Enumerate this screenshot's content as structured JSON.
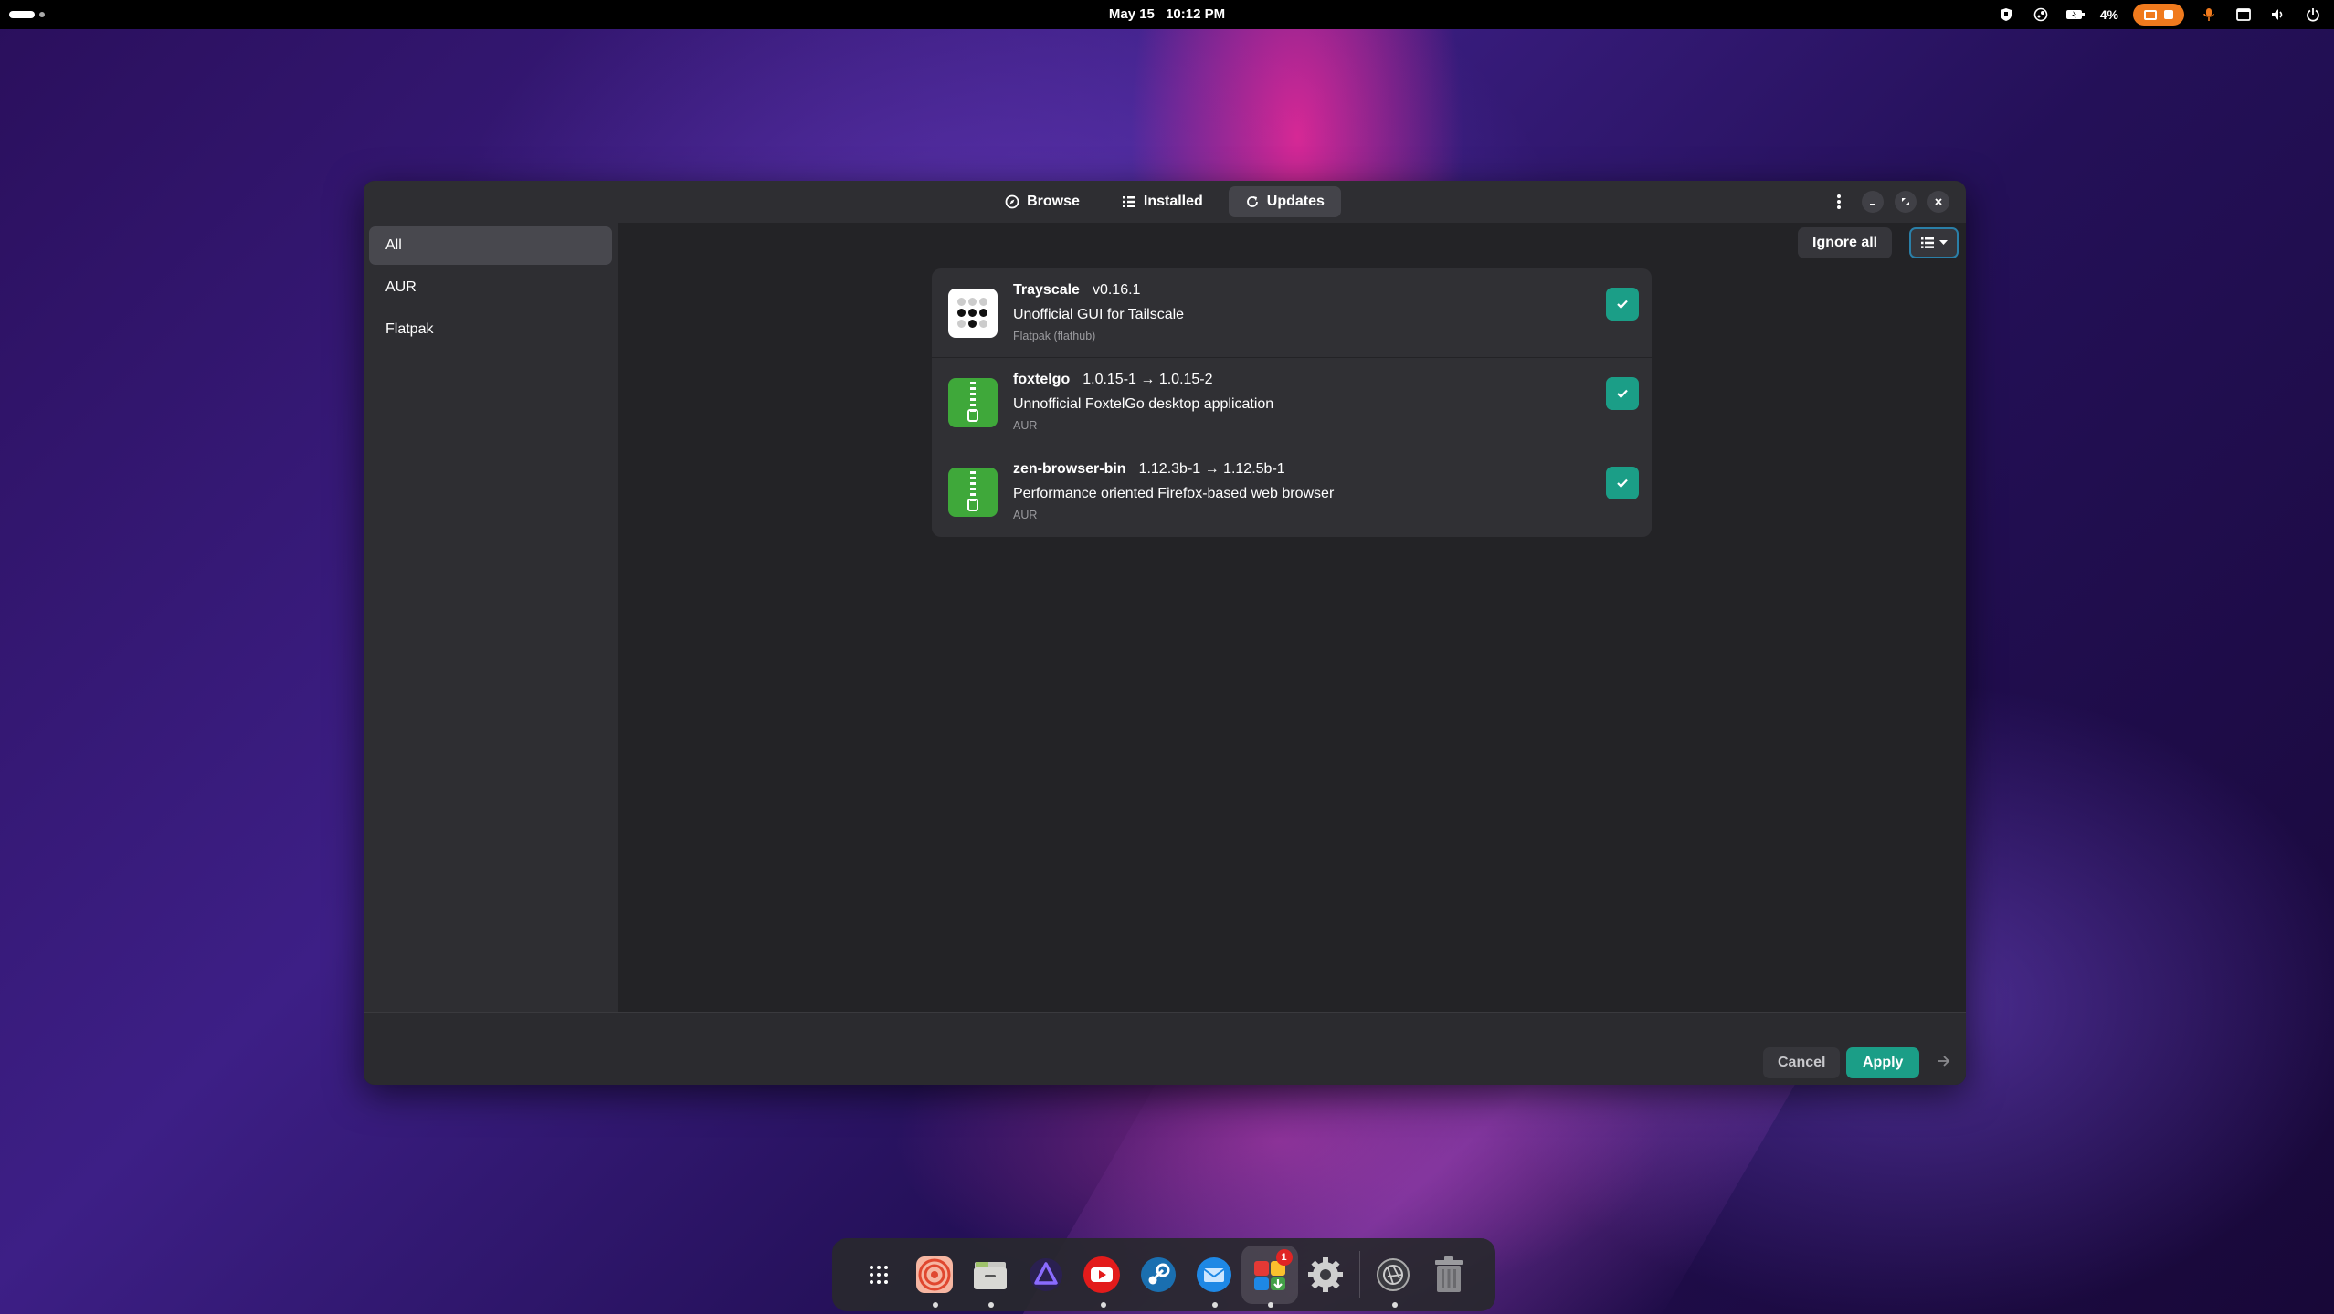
{
  "topbar": {
    "date": "May 15",
    "time": "10:12 PM",
    "battery_percent": "4%",
    "tray_icons": [
      "shield-icon",
      "steam-icon",
      "battery-icon",
      "recording-indicator-icon",
      "microphone-icon",
      "window-icon",
      "volume-icon",
      "power-icon"
    ]
  },
  "window": {
    "tabs": [
      {
        "label": "Browse",
        "icon": "compass-icon",
        "active": false
      },
      {
        "label": "Installed",
        "icon": "list-icon",
        "active": false
      },
      {
        "label": "Updates",
        "icon": "refresh-icon",
        "active": true
      }
    ],
    "sidebar": {
      "items": [
        {
          "label": "All",
          "active": true
        },
        {
          "label": "AUR",
          "active": false
        },
        {
          "label": "Flatpak",
          "active": false
        }
      ]
    },
    "toolbar": {
      "ignore_all_label": "Ignore all",
      "view_icon": "list-view-icon"
    },
    "updates": [
      {
        "name": "Trayscale",
        "version": "v0.16.1",
        "description": "Unofficial GUI for Tailscale",
        "source": "Flatpak (flathub)",
        "checked": true,
        "icon": "trayscale-icon"
      },
      {
        "name": "foxtelgo",
        "version": "1.0.15-1 → 1.0.15-2",
        "description": "Unnofficial FoxtelGo desktop application",
        "source": "AUR",
        "checked": true,
        "icon": "archive-package-icon"
      },
      {
        "name": "zen-browser-bin",
        "version": "1.12.3b-1 → 1.12.5b-1",
        "description": "Performance oriented Firefox-based web browser",
        "source": "AUR",
        "checked": true,
        "icon": "archive-package-icon"
      }
    ],
    "footer": {
      "cancel_label": "Cancel",
      "apply_label": "Apply"
    }
  },
  "dock": {
    "items": [
      "app-grid-icon",
      "target-app-icon",
      "file-manager-icon",
      "proton-vpn-icon",
      "youtube-icon",
      "steam-icon",
      "thunderbird-icon",
      "software-updater-icon",
      "settings-icon",
      "aperture-icon",
      "trash-icon"
    ],
    "updater_badge": "1"
  },
  "colors": {
    "accent": "#1b9e87",
    "window_bg": "#222226",
    "headerbar_bg": "#2e2e32",
    "recording_orange": "#f07a1d"
  }
}
